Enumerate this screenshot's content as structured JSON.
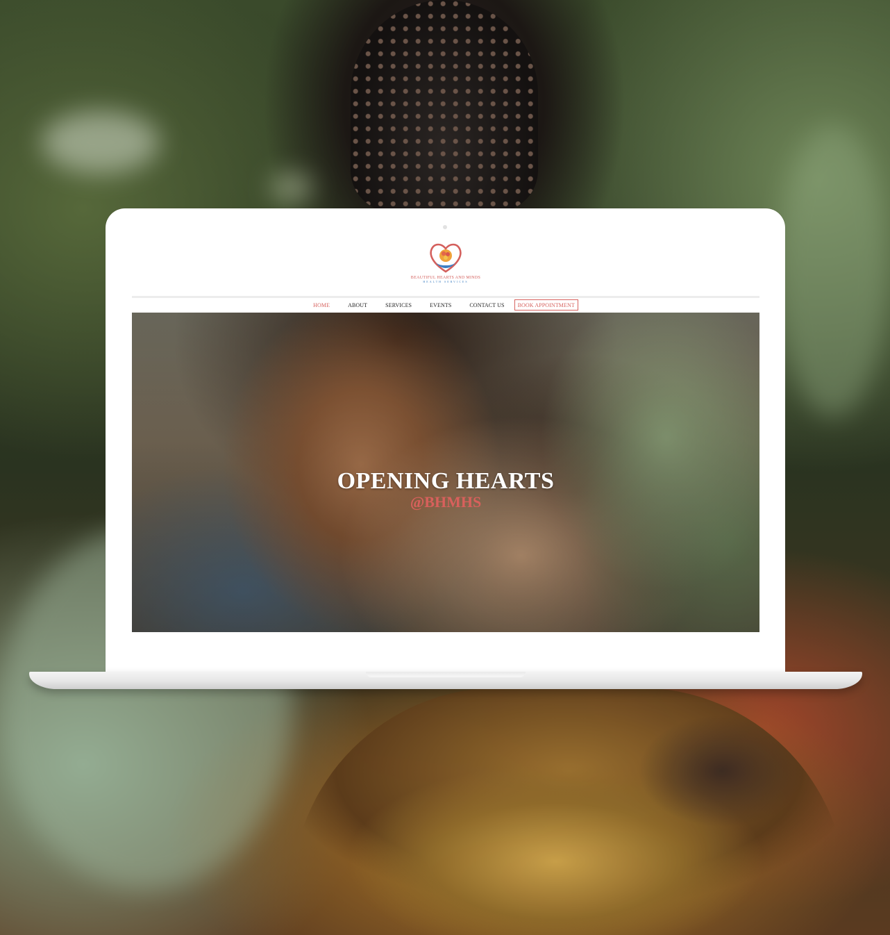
{
  "site": {
    "logo_name": "BEAUTIFUL HEARTS AND MINDS",
    "logo_sub": "HEALTH SERVICES",
    "logo_tagline": "",
    "logo_icon": "heart-hands-logo-icon"
  },
  "nav": {
    "items": [
      {
        "label": "HOME",
        "active": true
      },
      {
        "label": "ABOUT"
      },
      {
        "label": "SERVICES"
      },
      {
        "label": "EVENTS"
      },
      {
        "label": "CONTACT US"
      }
    ],
    "cta_label": "BOOK APPOINTMENT"
  },
  "hero": {
    "title": "OPENING HEARTS",
    "handle": "@BHMHS"
  },
  "colors": {
    "accent": "#d7625e",
    "logo_blue": "#3e7fc2",
    "text": "#222222"
  }
}
